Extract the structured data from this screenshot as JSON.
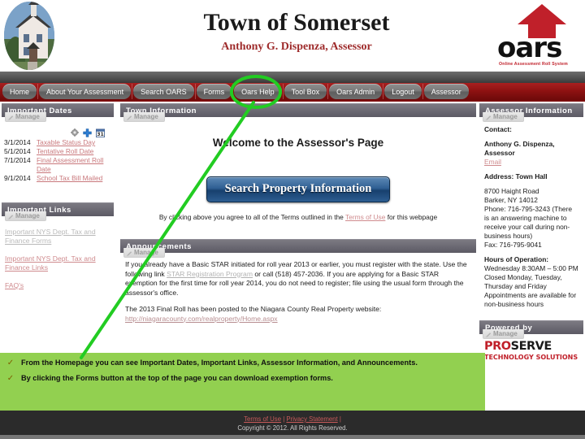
{
  "header": {
    "town_title": "Town of Somerset",
    "assessor_subtitle": "Anthony G. Dispenza, Assessor",
    "logo_word": "oars",
    "logo_tagline": "Online Assessment Roll System",
    "photo_alt": "town-building-photo"
  },
  "nav": {
    "items": [
      {
        "label": "Home"
      },
      {
        "label": "About Your Assessment"
      },
      {
        "label": "Search OARS"
      },
      {
        "label": "Forms"
      },
      {
        "label": "Oars Help"
      },
      {
        "label": "Tool Box"
      },
      {
        "label": "Oars Admin"
      },
      {
        "label": "Logout"
      },
      {
        "label": "Assessor"
      }
    ],
    "highlighted": "Forms"
  },
  "manage_label": "Manage",
  "sidebar_left": {
    "dates_panel": {
      "title": "Important Dates",
      "icons": [
        "gear-icon",
        "plus-icon",
        "calendar-icon"
      ],
      "calendar_icon_day": "31",
      "rows": [
        {
          "date": "3/1/2014",
          "label": "Taxable Status Day"
        },
        {
          "date": "5/1/2014",
          "label": "Tentative Roll Date"
        },
        {
          "date": "7/1/2014",
          "label": "Final Assessment Roll Date"
        },
        {
          "date": "9/1/2014",
          "label": "School Tax Bill Mailed"
        }
      ]
    },
    "links_panel": {
      "title": "Important Links",
      "links": [
        "Important NYS Dept. Tax and Finance Forms",
        "Important NYS Dept. Tax and Finance Links",
        "FAQ's"
      ]
    }
  },
  "main": {
    "town_info_panel": {
      "title": "Town Information",
      "welcome": "Welcome to the  Assessor's Page",
      "search_button": "Search Property Information",
      "terms_prefix": "By clicking above you agree to all of the Terms outlined in the ",
      "terms_link": "Terms of Use",
      "terms_suffix": " for this webpage"
    },
    "announcements_panel": {
      "title": "Announcements",
      "p1_a": "If you already have a Basic STAR initiated for roll year 2013 or earlier, you must register with the state. Use the following link ",
      "p1_link": "STAR Registration Program",
      "p1_b": " or call (518) 457-2036. If you are applying for a Basic STAR exemption for the first time for roll year 2014, you do not need to register; file using the usual form through the assessor's office.",
      "p2_a": "The 2013 Final Roll has been posted to the Niagara County Real Property website:",
      "p2_link": "http://niagaracounty.com/realproperty/Home.aspx"
    }
  },
  "sidebar_right": {
    "assessor_panel": {
      "title": "Assessor Information",
      "contact_label": "Contact:",
      "name": "Anthony G. Dispenza, Assessor",
      "email_link": "Email",
      "address_label": "Address: Town Hall",
      "address_line1": "8700 Haight Road",
      "address_line2": "Barker, NY  14012",
      "phone": "Phone:  716-795-3243 (There is an answering machine to receive your call during non-business hours)",
      "fax": "Fax:  716-795-9041",
      "hours_label": "Hours of Operation:",
      "hours_line1": " Wednesday 8:30AM – 5:00 PM",
      "hours_line2": "Closed Monday, Tuesday, Thursday and Friday",
      "hours_line3": "Appointments are available for non-business hours"
    },
    "powered_panel": {
      "title": "Powered by",
      "logo_pro": "PRO",
      "logo_serve": "SERVE",
      "logo_sub": "TECHNOLOGY SOLUTIONS"
    }
  },
  "footer": {
    "terms_of_use": "Terms of Use",
    "separator1": " | ",
    "privacy_statement": "Privacy Statement",
    "separator2": " |",
    "copyright": "Copyright © 2012. All Rights Reserved."
  },
  "annotation": {
    "check_glyph": "✓",
    "lines": [
      "From the Homepage you can see Important Dates, Important Links, Assessor Information, and Announcements.",
      "By clicking the Forms button at the top of the page you can download exemption forms."
    ],
    "color": "#92d050",
    "pointer_color": "#22cc22",
    "pointer_target": "Forms"
  }
}
